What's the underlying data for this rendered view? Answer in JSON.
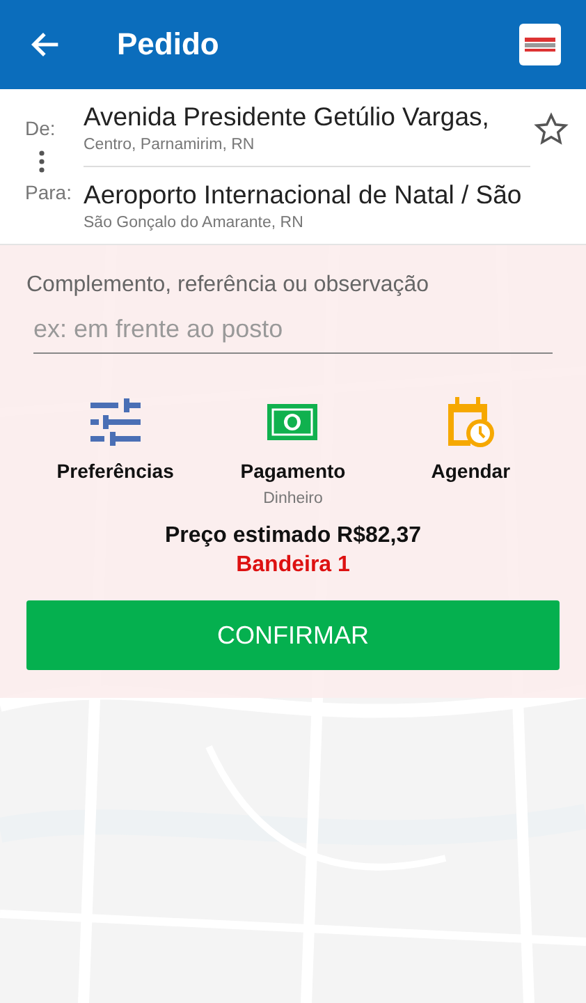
{
  "header": {
    "title": "Pedido"
  },
  "route": {
    "from_label": "De:",
    "from_title": "Avenida Presidente Getúlio Vargas,",
    "from_subtitle": "Centro, Parnamirim, RN",
    "to_label": "Para:",
    "to_title": "Aeroporto Internacional de Natal / São",
    "to_subtitle": "São Gonçalo do Amarante, RN"
  },
  "note": {
    "label": "Complemento, referência ou observação",
    "placeholder": "ex: em frente ao posto"
  },
  "options": [
    {
      "kind": "preferences",
      "label": "Preferências"
    },
    {
      "kind": "payment",
      "label": "Pagamento",
      "detail": "Dinheiro"
    },
    {
      "kind": "schedule",
      "label": "Agendar"
    }
  ],
  "estimate": {
    "price": "Preço estimado R$82,37",
    "flag": "Bandeira 1"
  },
  "confirm_button": "CONFIRMAR"
}
